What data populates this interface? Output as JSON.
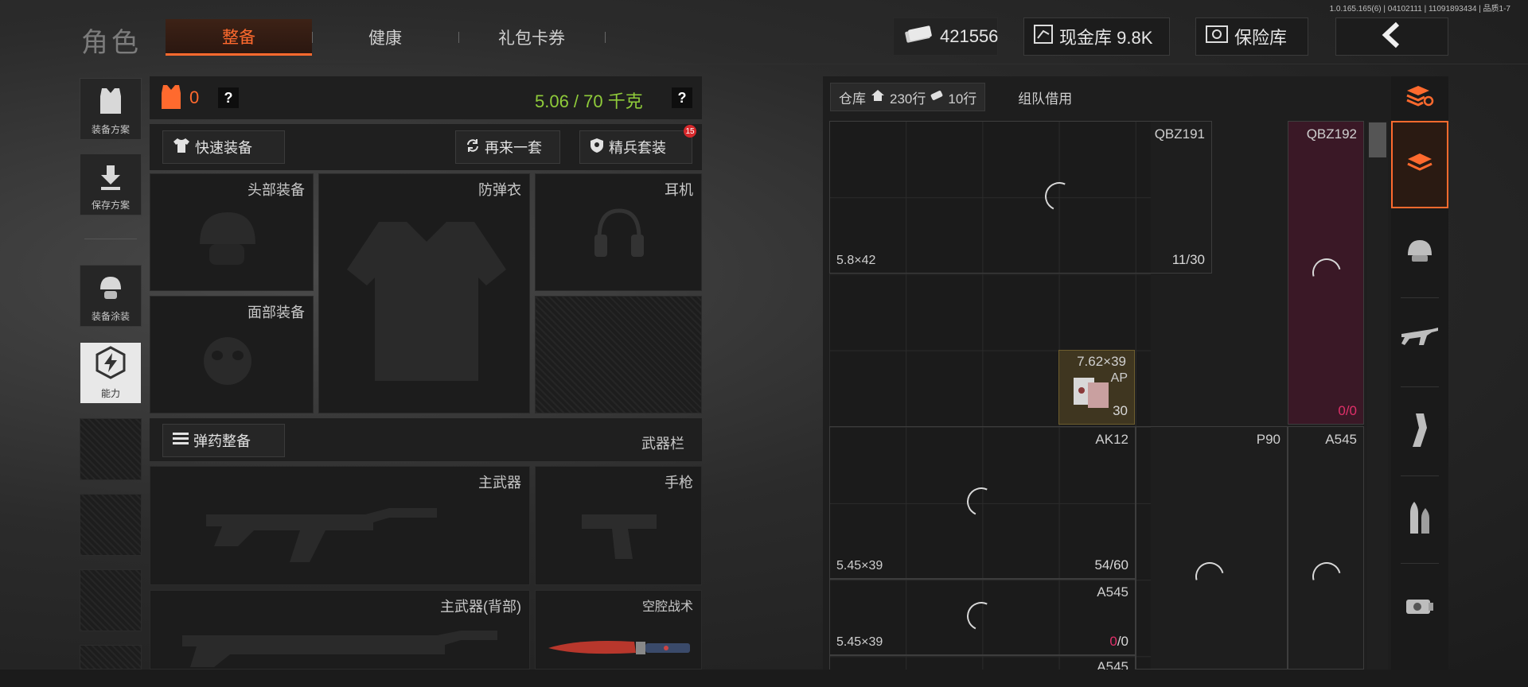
{
  "version": "1.0.165.165(6) | 04102111 | 11091893434 | 品质1-7",
  "header": {
    "title": "角色",
    "tabs": [
      {
        "label": "整备",
        "active": true
      },
      {
        "label": "健康",
        "active": false
      },
      {
        "label": "礼包卡券",
        "active": false
      }
    ],
    "cash": "421556",
    "cash_storage": "现金库 9.8K",
    "safe_box": "保险库"
  },
  "sidebar": {
    "items": [
      {
        "label": "装备方案",
        "icon": "armor-vest-icon"
      },
      {
        "label": "保存方案",
        "icon": "download-icon"
      },
      {
        "label": "装备涂装",
        "icon": "helmet-paint-icon"
      },
      {
        "label": "能力",
        "icon": "lightning-hex-icon"
      }
    ]
  },
  "loadout": {
    "armor_count": "0",
    "weight": "5.06 / 70 千克",
    "quick_equip": "快速装备",
    "reroll": "再来一套",
    "elite_set": "精兵套装",
    "elite_badge": "15",
    "slots": {
      "head": "头部装备",
      "vest": "防弹衣",
      "headset": "耳机",
      "face": "面部装备",
      "primary": "主武器",
      "pistol": "手枪",
      "primary_back": "主武器(背部)",
      "melee": "空腔战术"
    },
    "ammo_equip": "弹药整备",
    "weapon_bar": "武器栏"
  },
  "storage": {
    "tab_label": "仓库",
    "rows_total": "230行",
    "rows_expand": "10行",
    "team_borrow": "组队借用",
    "items": [
      {
        "name": "QBZ191",
        "caliber": "5.8×42",
        "count": "11/30"
      },
      {
        "name": "QBZ192",
        "count_used": "0",
        "count_total": "/0"
      },
      {
        "name": "7.62×39",
        "sub": "AP",
        "count": "30"
      },
      {
        "name": "AK12",
        "caliber": "5.45×39",
        "count": "54/60"
      },
      {
        "name": "P90"
      },
      {
        "name": "A545"
      },
      {
        "name": "A545",
        "caliber": "5.45×39",
        "count_used": "0",
        "count_total": "/0"
      },
      {
        "name": "A545"
      }
    ]
  },
  "categories": [
    "all-items-icon",
    "helmet-icon",
    "rifle-icon",
    "magazine-icon",
    "bullets-icon",
    "sight-icon"
  ],
  "colors": {
    "accent": "#ff6a2e",
    "weight": "#8fcb3a",
    "alert": "#e0306a"
  }
}
